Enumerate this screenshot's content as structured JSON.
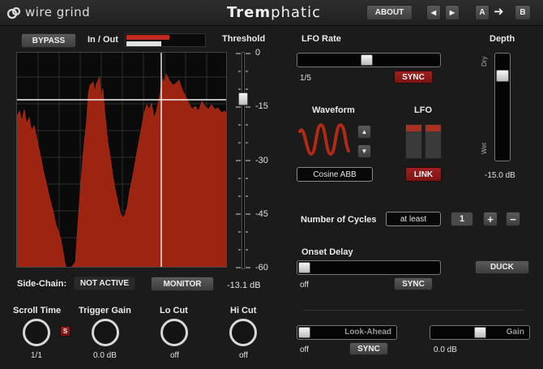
{
  "header": {
    "brand": "wire grind",
    "title_bold": "Trem",
    "title_light": "phatic",
    "about": "ABOUT",
    "prev": "◀",
    "next": "▶",
    "preset_a": "A",
    "copy_arrow": "➜",
    "preset_b": "B"
  },
  "meter": {
    "bypass": "BYPASS",
    "inout": "In / Out",
    "in_level": 0.55,
    "out_level": 0.45,
    "threshold_label": "Threshold",
    "threshold_ticks": [
      "0",
      "-15",
      "-30",
      "-45",
      "-60"
    ],
    "threshold_value": "-13.1 dB"
  },
  "sidechain": {
    "label": "Side-Chain:",
    "status": "NOT ACTIVE",
    "monitor": "MONITOR"
  },
  "knobs": [
    {
      "label": "Scroll Time",
      "value": "1/1"
    },
    {
      "label": "Trigger Gain",
      "value": "0.0 dB"
    },
    {
      "label": "Lo Cut",
      "value": "off"
    },
    {
      "label": "Hi Cut",
      "value": "off"
    }
  ],
  "scroll_s": "S",
  "lfo": {
    "rate_label": "LFO Rate",
    "rate_value": "1/5",
    "rate_sync": "SYNC",
    "waveform_label": "Waveform",
    "waveform_name": "Cosine ABB",
    "lfo_label": "LFO",
    "link": "LINK",
    "up": "▲",
    "down": "▼"
  },
  "depth": {
    "label": "Depth",
    "dry": "Dry",
    "wet": "Wet",
    "value": "-15.0 dB"
  },
  "cycles": {
    "label": "Number of Cycles",
    "mode": "at least",
    "count": "1",
    "plus": "+",
    "minus": "−"
  },
  "onset": {
    "label": "Onset Delay",
    "value": "off",
    "sync": "SYNC",
    "duck": "DUCK"
  },
  "lookahead": {
    "label": "Look-Ahead",
    "value": "off",
    "sync": "SYNC"
  },
  "gain": {
    "label": "Gain",
    "value": "0.0 dB"
  },
  "colors": {
    "accent": "#a31c1c",
    "waveform": "#9c2410"
  }
}
